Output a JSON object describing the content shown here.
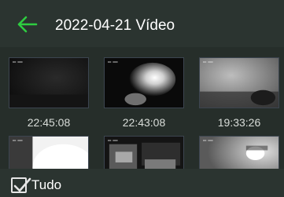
{
  "header": {
    "back_icon": "arrow-left-icon",
    "accent_color": "#2ecc40",
    "title": "2022-04-21 Vídeo"
  },
  "videos": [
    {
      "time": "22:45:08",
      "scene": "dark-night"
    },
    {
      "time": "22:43:08",
      "scene": "bright-light-blur"
    },
    {
      "time": "19:33:26",
      "scene": "dim-grey-room"
    },
    {
      "time": "",
      "scene": "white-overexposed"
    },
    {
      "time": "",
      "scene": "car-interior"
    },
    {
      "time": "",
      "scene": "grey-night-light"
    }
  ],
  "footer": {
    "select_all_label": "Tudo",
    "select_all_checked": true
  }
}
